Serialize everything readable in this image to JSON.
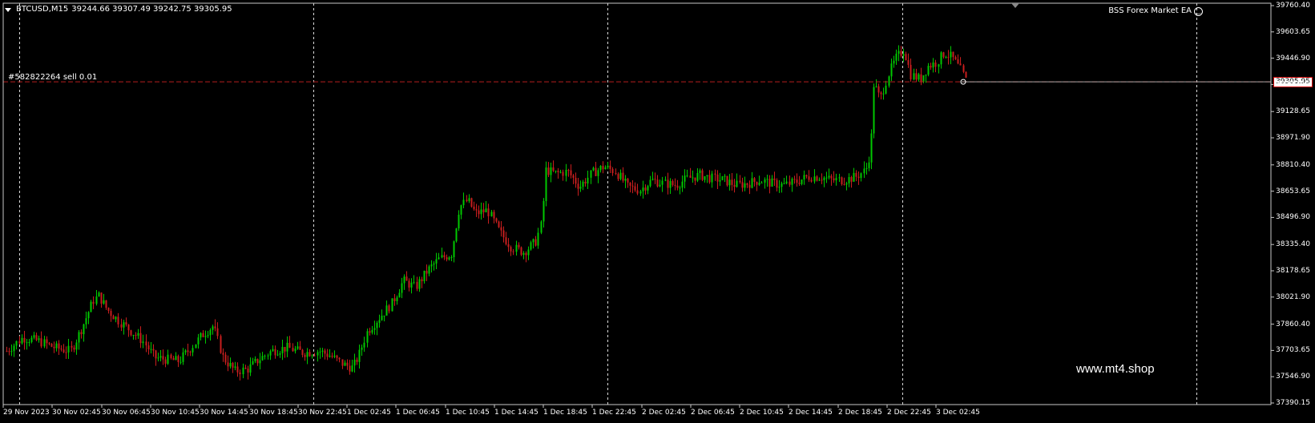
{
  "header": {
    "symbol": "BTCUSD,M15",
    "ohlc": "39244.66 39307.49 39242.75 39305.95"
  },
  "ea": {
    "name": "BSS Forex Market EA"
  },
  "order": {
    "label": "#582822264 sell 0.01"
  },
  "watermark": "www.mt4.shop",
  "current_price": "39305.95",
  "colors": {
    "background": "#000000",
    "bull": "#00c800",
    "bear": "#c81e1e",
    "grid": "#ffffff",
    "order_line": "#b41e1e"
  },
  "y_axis": {
    "labels": [
      "39760.40",
      "39603.65",
      "39446.90",
      "39290.15",
      "39128.65",
      "38971.90",
      "38810.40",
      "38653.65",
      "38496.90",
      "38335.40",
      "38178.65",
      "38021.90",
      "37860.40",
      "37703.65",
      "37546.90",
      "37390.15"
    ]
  },
  "x_axis": {
    "labels": [
      "29 Nov 2023",
      "30 Nov 02:45",
      "30 Nov 06:45",
      "30 Nov 10:45",
      "30 Nov 14:45",
      "30 Nov 18:45",
      "30 Nov 22:45",
      "1 Dec 02:45",
      "1 Dec 06:45",
      "1 Dec 10:45",
      "1 Dec 14:45",
      "1 Dec 18:45",
      "1 Dec 22:45",
      "2 Dec 02:45",
      "2 Dec 06:45",
      "2 Dec 10:45",
      "2 Dec 14:45",
      "2 Dec 18:45",
      "2 Dec 22:45",
      "3 Dec 02:45"
    ]
  },
  "chart_data": {
    "type": "candlestick",
    "symbol": "BTCUSD",
    "timeframe": "M15",
    "ylim": [
      37390.15,
      39760.4
    ],
    "order_price": 39305.95,
    "close_path": [
      [
        0,
        37700
      ],
      [
        20,
        37780
      ],
      [
        40,
        37760
      ],
      [
        60,
        37720
      ],
      [
        80,
        37700
      ],
      [
        95,
        37850
      ],
      [
        108,
        38000
      ],
      [
        115,
        38030
      ],
      [
        125,
        37950
      ],
      [
        140,
        37880
      ],
      [
        155,
        37820
      ],
      [
        170,
        37760
      ],
      [
        185,
        37660
      ],
      [
        200,
        37650
      ],
      [
        215,
        37640
      ],
      [
        230,
        37720
      ],
      [
        245,
        37800
      ],
      [
        258,
        37850
      ],
      [
        270,
        37660
      ],
      [
        285,
        37580
      ],
      [
        300,
        37590
      ],
      [
        315,
        37650
      ],
      [
        330,
        37700
      ],
      [
        350,
        37720
      ],
      [
        370,
        37690
      ],
      [
        390,
        37700
      ],
      [
        405,
        37670
      ],
      [
        420,
        37620
      ],
      [
        432,
        37600
      ],
      [
        440,
        37680
      ],
      [
        450,
        37820
      ],
      [
        465,
        37900
      ],
      [
        480,
        37980
      ],
      [
        495,
        38120
      ],
      [
        510,
        38080
      ],
      [
        525,
        38180
      ],
      [
        540,
        38250
      ],
      [
        555,
        38280
      ],
      [
        565,
        38560
      ],
      [
        575,
        38600
      ],
      [
        585,
        38520
      ],
      [
        600,
        38540
      ],
      [
        615,
        38410
      ],
      [
        630,
        38320
      ],
      [
        645,
        38290
      ],
      [
        660,
        38350
      ],
      [
        668,
        38470
      ],
      [
        672,
        38780
      ],
      [
        685,
        38760
      ],
      [
        700,
        38770
      ],
      [
        715,
        38680
      ],
      [
        730,
        38760
      ],
      [
        745,
        38800
      ],
      [
        760,
        38770
      ],
      [
        775,
        38680
      ],
      [
        790,
        38660
      ],
      [
        805,
        38720
      ],
      [
        820,
        38700
      ],
      [
        835,
        38690
      ],
      [
        850,
        38730
      ],
      [
        865,
        38750
      ],
      [
        880,
        38730
      ],
      [
        895,
        38720
      ],
      [
        910,
        38690
      ],
      [
        925,
        38700
      ],
      [
        940,
        38720
      ],
      [
        955,
        38700
      ],
      [
        970,
        38690
      ],
      [
        985,
        38710
      ],
      [
        1000,
        38740
      ],
      [
        1015,
        38740
      ],
      [
        1030,
        38720
      ],
      [
        1045,
        38720
      ],
      [
        1060,
        38740
      ],
      [
        1072,
        38780
      ],
      [
        1078,
        38900
      ],
      [
        1082,
        39300
      ],
      [
        1090,
        39200
      ],
      [
        1100,
        39350
      ],
      [
        1110,
        39450
      ],
      [
        1120,
        39500
      ],
      [
        1128,
        39350
      ],
      [
        1140,
        39320
      ],
      [
        1150,
        39400
      ],
      [
        1160,
        39420
      ],
      [
        1170,
        39480
      ],
      [
        1180,
        39450
      ],
      [
        1190,
        39380
      ],
      [
        1198,
        39300
      ],
      [
        1206,
        39305.95
      ]
    ]
  }
}
